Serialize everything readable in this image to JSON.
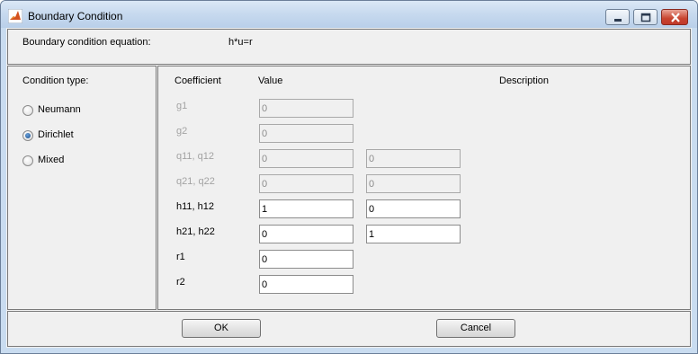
{
  "window": {
    "title": "Boundary Condition",
    "icon": "matlab-icon"
  },
  "equation": {
    "label": "Boundary condition equation:",
    "value": "h*u=r"
  },
  "condition_type": {
    "label": "Condition type:",
    "options": [
      {
        "label": "Neumann",
        "selected": false
      },
      {
        "label": "Dirichlet",
        "selected": true
      },
      {
        "label": "Mixed",
        "selected": false
      }
    ]
  },
  "coefficients": {
    "headers": {
      "coefficient": "Coefficient",
      "value": "Value",
      "description": "Description"
    },
    "rows": [
      {
        "name": "g1",
        "enabled": false,
        "values": [
          "0"
        ]
      },
      {
        "name": "g2",
        "enabled": false,
        "values": [
          "0"
        ]
      },
      {
        "name": "q11, q12",
        "enabled": false,
        "values": [
          "0",
          "0"
        ]
      },
      {
        "name": "q21, q22",
        "enabled": false,
        "values": [
          "0",
          "0"
        ]
      },
      {
        "name": "h11, h12",
        "enabled": true,
        "values": [
          "1",
          "0"
        ]
      },
      {
        "name": "h21, h22",
        "enabled": true,
        "values": [
          "0",
          "1"
        ]
      },
      {
        "name": "r1",
        "enabled": true,
        "values": [
          "0"
        ]
      },
      {
        "name": "r2",
        "enabled": true,
        "values": [
          "0"
        ]
      }
    ]
  },
  "buttons": {
    "ok": "OK",
    "cancel": "Cancel"
  }
}
